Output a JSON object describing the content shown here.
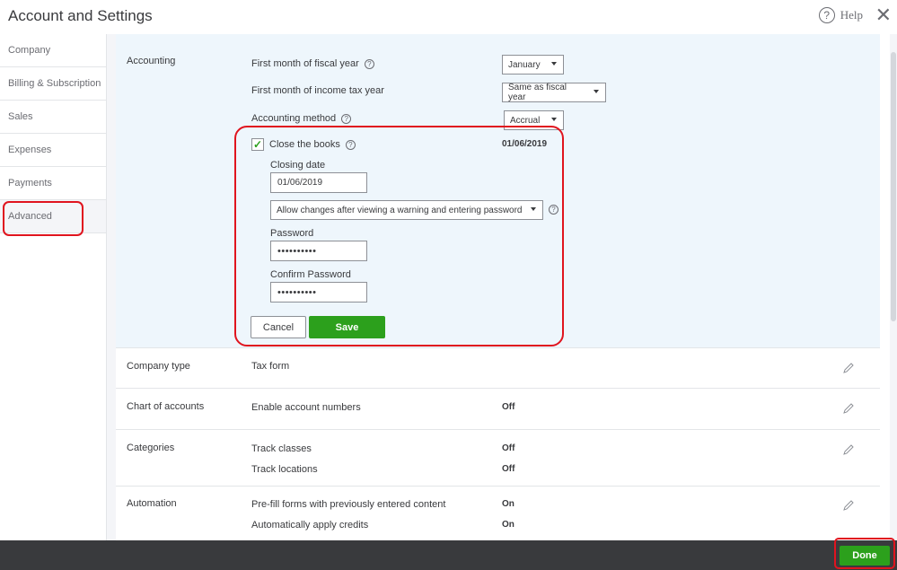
{
  "header": {
    "title": "Account and Settings",
    "help_label": "Help",
    "help_icon": "?",
    "close_icon": "✕"
  },
  "sidebar": {
    "items": [
      {
        "label": "Company"
      },
      {
        "label": "Billing & Subscription"
      },
      {
        "label": "Sales"
      },
      {
        "label": "Expenses"
      },
      {
        "label": "Payments"
      },
      {
        "label": "Advanced",
        "active": true
      }
    ]
  },
  "accounting": {
    "title": "Accounting",
    "fiscal_year_label": "First month of fiscal year",
    "fiscal_year_value": "January",
    "income_tax_label": "First month of income tax year",
    "income_tax_value": "Same as fiscal year",
    "method_label": "Accounting method",
    "method_value": "Accrual",
    "close_books_label": "Close the books",
    "close_books_checked": true,
    "close_books_date": "01/06/2019",
    "closing_date_label": "Closing date",
    "closing_date_value": "01/06/2019",
    "allow_changes_value": "Allow changes after viewing a warning and entering password",
    "password_label": "Password",
    "password_value": "••••••••••",
    "confirm_password_label": "Confirm Password",
    "confirm_password_value": "••••••••••",
    "cancel_label": "Cancel",
    "save_label": "Save",
    "check_mark": "✓",
    "question_icon": "?"
  },
  "company_type": {
    "title": "Company type",
    "label": "Tax form"
  },
  "chart_of_accounts": {
    "title": "Chart of accounts",
    "label": "Enable account numbers",
    "value": "Off"
  },
  "categories": {
    "title": "Categories",
    "rows": [
      {
        "label": "Track classes",
        "value": "Off"
      },
      {
        "label": "Track locations",
        "value": "Off"
      }
    ]
  },
  "automation": {
    "title": "Automation",
    "rows": [
      {
        "label": "Pre-fill forms with previously entered content",
        "value": "On"
      },
      {
        "label": "Automatically apply credits",
        "value": "On"
      }
    ]
  },
  "footer": {
    "done_label": "Done"
  },
  "colors": {
    "accent": "#2ca01c",
    "highlight": "#e0141e",
    "footer": "#393a3d"
  }
}
